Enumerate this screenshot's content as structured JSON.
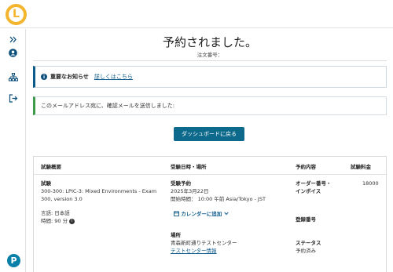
{
  "header": {
    "logo_letter": "L"
  },
  "sidebar": {
    "items": [
      {
        "icon": "double-chevron-right-icon"
      },
      {
        "icon": "user-circle-icon"
      },
      {
        "icon": "sitemap-icon"
      },
      {
        "icon": "logout-icon"
      }
    ],
    "footer_logo": "P"
  },
  "page": {
    "title": "予約されました。",
    "order_label": "注文番号："
  },
  "notice": {
    "label": "重要なお知らせ",
    "link": "詳しくはこちら"
  },
  "email_message": "このメールアドレス宛に、確認メールを送信しました:",
  "dashboard_button": "ダッシュボードに戻る",
  "table": {
    "headers": {
      "exam": "試験概要",
      "datetime": "受験日時・場所",
      "booking": "予約内容",
      "fee": "試験料金"
    },
    "exam": {
      "label": "試験",
      "name": "300-300: LPIC-3: Mixed Environments - Exam 300, version 3.0",
      "language": "言語: 日本語",
      "duration": "時間: 90 分"
    },
    "appointment": {
      "label": "受験予約",
      "date": "2025年3月22日",
      "start": "開始時間： 10:00 午前 Asia/Tokyo - JST",
      "calendar": "カレンダーに追加"
    },
    "location": {
      "label": "場所",
      "name": "青森新町通りテストセンター",
      "link": "テストセンター情報"
    },
    "booking": {
      "order_label": "オーダー番号・インボイス",
      "registration_label": "登録番号",
      "status_label": "ステータス",
      "status_value": "予約済み"
    },
    "fee": "18000"
  },
  "colors": {
    "accent": "#0e6a8c",
    "notice_border": "#0b5a8a",
    "success_border": "#3d9b4b",
    "logo": "#f2b52d"
  }
}
